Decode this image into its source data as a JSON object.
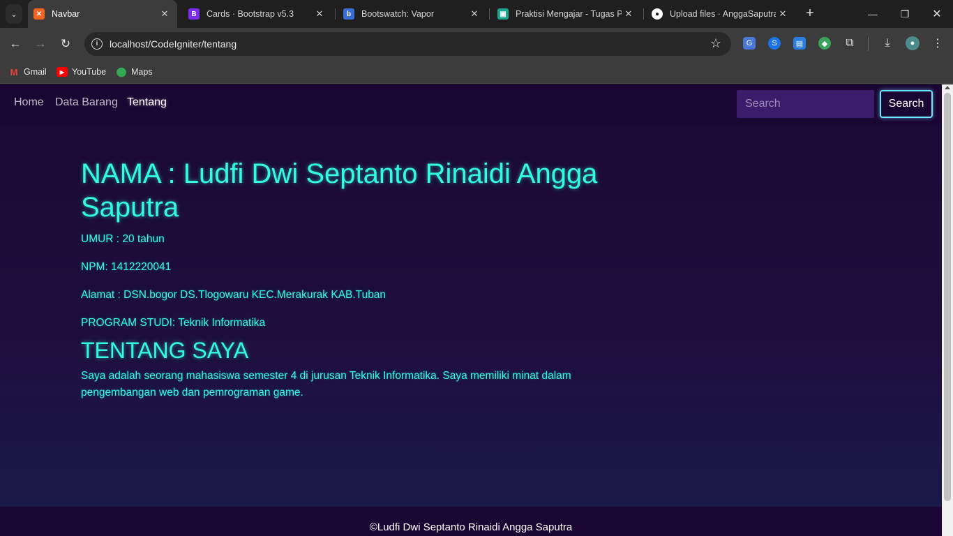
{
  "browser": {
    "tabs": [
      {
        "title": "Navbar",
        "active": true,
        "favicon": "xampp-icon",
        "color": "#f26522"
      },
      {
        "title": "Cards · Bootstrap v5.3",
        "active": false,
        "favicon": "bootstrap-icon",
        "color": "#7a2cf4"
      },
      {
        "title": "Bootswatch: Vapor",
        "active": false,
        "favicon": "bootswatch-icon",
        "color": "#3b6ed6"
      },
      {
        "title": "Praktisi Mengajar - Tugas Pe",
        "active": false,
        "favicon": "classroom-icon",
        "color": "#1aa58f"
      },
      {
        "title": "Upload files · AnggaSaputra",
        "active": false,
        "favicon": "github-icon",
        "color": "#ffffff"
      }
    ],
    "url": "localhost/CodeIgniter/tentang",
    "bookmarks": [
      {
        "label": "Gmail",
        "icon": "gmail-icon"
      },
      {
        "label": "YouTube",
        "icon": "youtube-icon"
      },
      {
        "label": "Maps",
        "icon": "maps-icon"
      }
    ]
  },
  "site": {
    "nav": {
      "links": [
        {
          "label": "Home",
          "active": false
        },
        {
          "label": "Data Barang",
          "active": false
        },
        {
          "label": "Tentang",
          "active": true
        }
      ],
      "search_placeholder": "Search",
      "search_button": "Search"
    },
    "profile": {
      "name_heading": "NAMA : Ludfi Dwi Septanto Rinaidi Angga Saputra",
      "age": "UMUR : 20 tahun",
      "npm": "NPM: 1412220041",
      "address": "Alamat : DSN.bogor DS.Tlogowaru KEC.Merakurak KAB.Tuban",
      "program": "PROGRAM STUDI: Teknik Informatika",
      "about_heading": "TENTANG SAYA",
      "about_text": "Saya adalah seorang mahasiswa semester 4 di jurusan Teknik Informatika. Saya memiliki minat dalam pengembangan web dan pemrograman game."
    },
    "footer": "©Ludfi Dwi Septanto Rinaidi Angga Saputra",
    "colors": {
      "accent": "#32fbe2",
      "navbar": "#1a0633",
      "button_border": "#6fe5ff"
    }
  }
}
